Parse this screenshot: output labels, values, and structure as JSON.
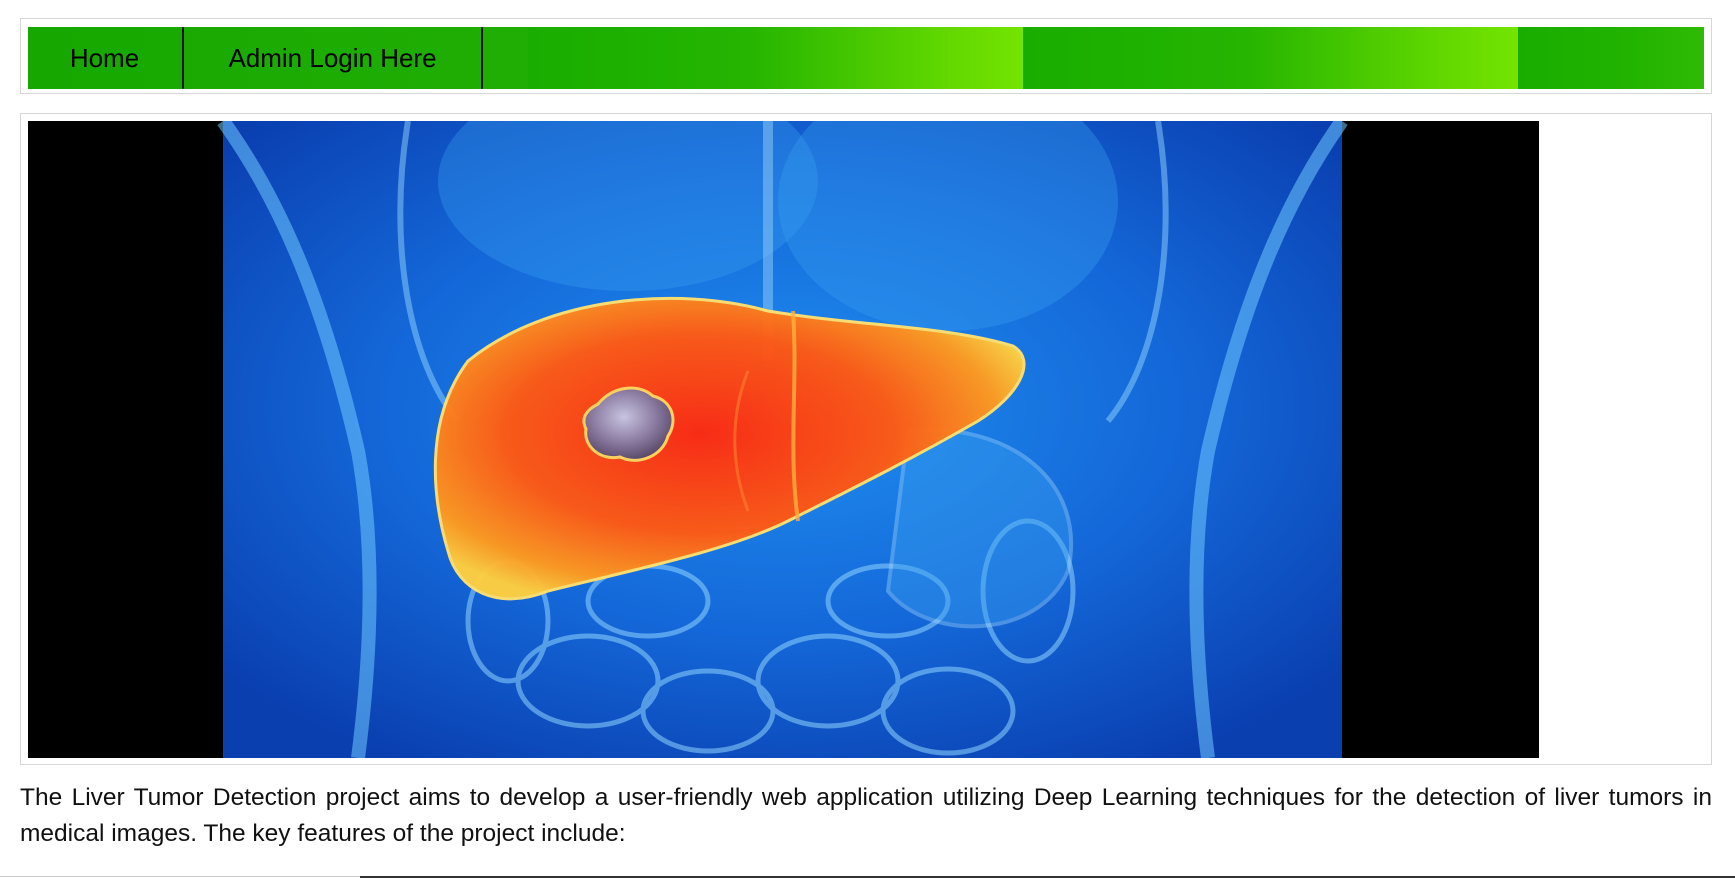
{
  "nav": {
    "items": [
      {
        "label": "Home"
      },
      {
        "label": "Admin Login Here"
      }
    ],
    "colors": {
      "bar": "#1aad00",
      "bar_highlight": "#74e400",
      "divider": "#111111"
    }
  },
  "hero": {
    "image_subject": "liver-tumor-xray-illustration",
    "colors": {
      "background": "#000000",
      "body": "#1e7fe0",
      "liver": "#ff4a10",
      "tumor": "#8a7a9a"
    }
  },
  "description": {
    "text": "The Liver Tumor Detection project aims to develop a user-friendly web application utilizing Deep Learning techniques for the detection of liver tumors in medical images. The key features of the project include:"
  }
}
